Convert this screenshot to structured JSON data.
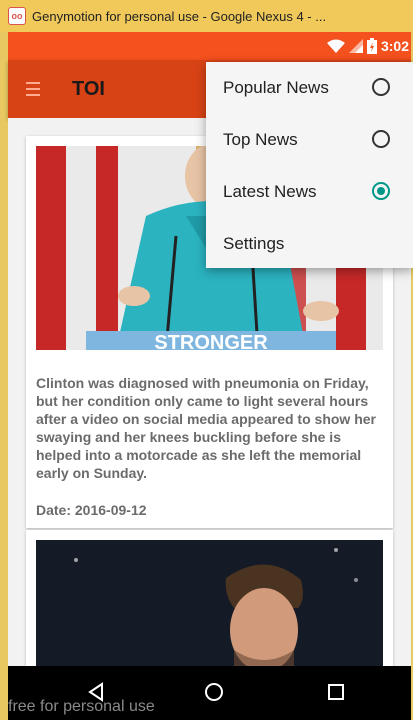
{
  "window": {
    "title": "Genymotion for personal use - Google Nexus 4 - ...",
    "logo_icon": "genymotion-logo-icon",
    "watermark": "free for personal use"
  },
  "status_bar": {
    "time": "3:02",
    "color": "#f4511e",
    "icons": [
      "wifi-icon",
      "signal-icon",
      "battery-icon"
    ]
  },
  "toolbar": {
    "title": "TOI",
    "color": "#d84315",
    "menu_icon": "hamburger-icon"
  },
  "overflow_menu": {
    "items": [
      {
        "label": "Popular News",
        "type": "radio",
        "checked": false
      },
      {
        "label": "Top News",
        "type": "radio",
        "checked": false
      },
      {
        "label": "Latest News",
        "type": "radio",
        "checked": true
      },
      {
        "label": "Settings",
        "type": "action"
      }
    ],
    "accent_color": "#009688"
  },
  "news": [
    {
      "image": "clinton-podium-photo",
      "image_caption_text": "STRONGER",
      "text": "Clinton was diagnosed with pneumonia on Friday, but her condition only came to light several hours after a video on social media appeared to show her swaying and her knees buckling before she is helped into a motorcade as she left the memorial early on Sunday.",
      "date": "Date: 2016-09-12"
    },
    {
      "image": "tennis-player-photo"
    }
  ],
  "nav_bar": {
    "buttons": [
      "back-icon",
      "home-icon",
      "recents-icon"
    ]
  }
}
